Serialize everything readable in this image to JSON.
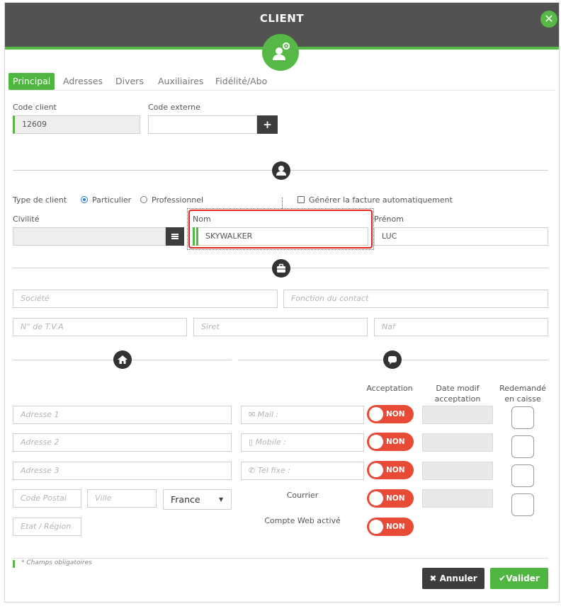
{
  "window": {
    "title": "CLIENT",
    "close_icon": "close-icon"
  },
  "tabs": [
    {
      "label": "Principal",
      "active": true
    },
    {
      "label": "Adresses"
    },
    {
      "label": "Divers"
    },
    {
      "label": "Auxiliaires"
    },
    {
      "label": "Fidélité/Abo"
    }
  ],
  "client_code": {
    "label": "Code client",
    "value": "12609"
  },
  "external_code": {
    "label": "Code externe",
    "value": "",
    "add_label": "+"
  },
  "client_type": {
    "label": "Type de client",
    "options": [
      "Particulier",
      "Professionnel"
    ],
    "selected": "Particulier",
    "auto_invoice_label": "Générer la facture automatiquement"
  },
  "civility": {
    "label": "Civilité",
    "value": ""
  },
  "last_name": {
    "label": "Nom",
    "value": "SKYWALKER"
  },
  "first_name": {
    "label": "Prénom",
    "value": "LUC"
  },
  "company": {
    "societe_placeholder": "Société",
    "fonction_placeholder": "Fonction du contact",
    "tva_placeholder": "N° de T.V.A",
    "siret_placeholder": "Siret",
    "naf_placeholder": "Naf"
  },
  "address": {
    "adresse1_placeholder": "Adresse 1",
    "adresse2_placeholder": "Adresse 2",
    "adresse3_placeholder": "Adresse 3",
    "cp_placeholder": "Code Postal",
    "ville_placeholder": "Ville",
    "country": "France",
    "region_placeholder": "Etat / Région"
  },
  "contact": {
    "col_acceptation": "Acceptation",
    "col_date_line1": "Date modif",
    "col_date_line2": "acceptation",
    "col_redemande_line1": "Redemandé",
    "col_redemande_line2": "en caisse",
    "mail_placeholder": "Mail :",
    "mobile_placeholder": "Mobile :",
    "tel_placeholder": "Tel fixe :",
    "courrier_label": "Courrier",
    "web_label": "Compte Web activé",
    "toggle_text": "NON"
  },
  "footer": {
    "required_note": "* Champs obligatoires",
    "cancel_label": "Annuler",
    "validate_label": "Valider"
  },
  "colors": {
    "accent": "#56b845",
    "header": "#525252",
    "toggle_off": "#e94a35",
    "dark_button": "#3d3d3d"
  }
}
